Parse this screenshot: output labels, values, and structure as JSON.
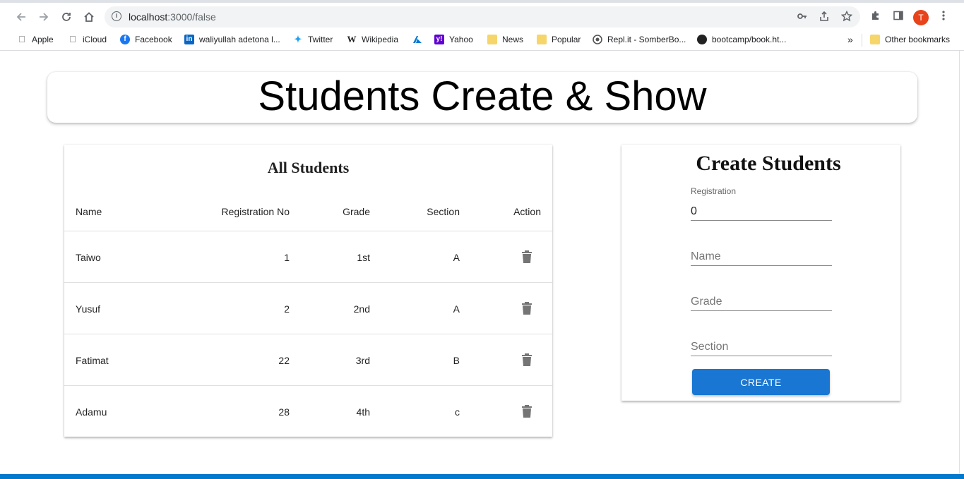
{
  "browser": {
    "url_host": "localhost",
    "url_path": ":3000/false",
    "avatar_letter": "T",
    "bookmarks": [
      {
        "label": "Apple",
        "icon": "apple-icon"
      },
      {
        "label": "iCloud",
        "icon": "apple-icon"
      },
      {
        "label": "Facebook",
        "icon": "facebook-icon"
      },
      {
        "label": "waliyullah adetona l...",
        "icon": "linkedin-icon"
      },
      {
        "label": "Twitter",
        "icon": "twitter-icon"
      },
      {
        "label": "Wikipedia",
        "icon": "wikipedia-icon"
      },
      {
        "label": "",
        "icon": "azure-icon"
      },
      {
        "label": "Yahoo",
        "icon": "yahoo-icon"
      },
      {
        "label": "News",
        "icon": "folder-icon"
      },
      {
        "label": "Popular",
        "icon": "folder-icon"
      },
      {
        "label": "Repl.it - SomberBo...",
        "icon": "replit-icon"
      },
      {
        "label": "bootcamp/book.ht...",
        "icon": "github-icon"
      }
    ],
    "overflow": "»",
    "other_bookmarks": "Other bookmarks"
  },
  "page": {
    "title": "Students Create & Show"
  },
  "table": {
    "title": "All Students",
    "headers": [
      "Name",
      "Registration No",
      "Grade",
      "Section",
      "Action"
    ],
    "rows": [
      {
        "name": "Taiwo",
        "reg": "1",
        "grade": "1st",
        "section": "A"
      },
      {
        "name": "Yusuf",
        "reg": "2",
        "grade": "2nd",
        "section": "A"
      },
      {
        "name": "Fatimat",
        "reg": "22",
        "grade": "3rd",
        "section": "B"
      },
      {
        "name": "Adamu",
        "reg": "28",
        "grade": "4th",
        "section": "c"
      }
    ]
  },
  "form": {
    "title": "Create Students",
    "registration_label": "Registration",
    "registration_value": "0",
    "name_placeholder": "Name",
    "grade_placeholder": "Grade",
    "section_placeholder": "Section",
    "create_label": "CREATE"
  },
  "colors": {
    "primary": "#1976d2",
    "avatar": "#e8431a",
    "icon_grey": "#757575"
  }
}
